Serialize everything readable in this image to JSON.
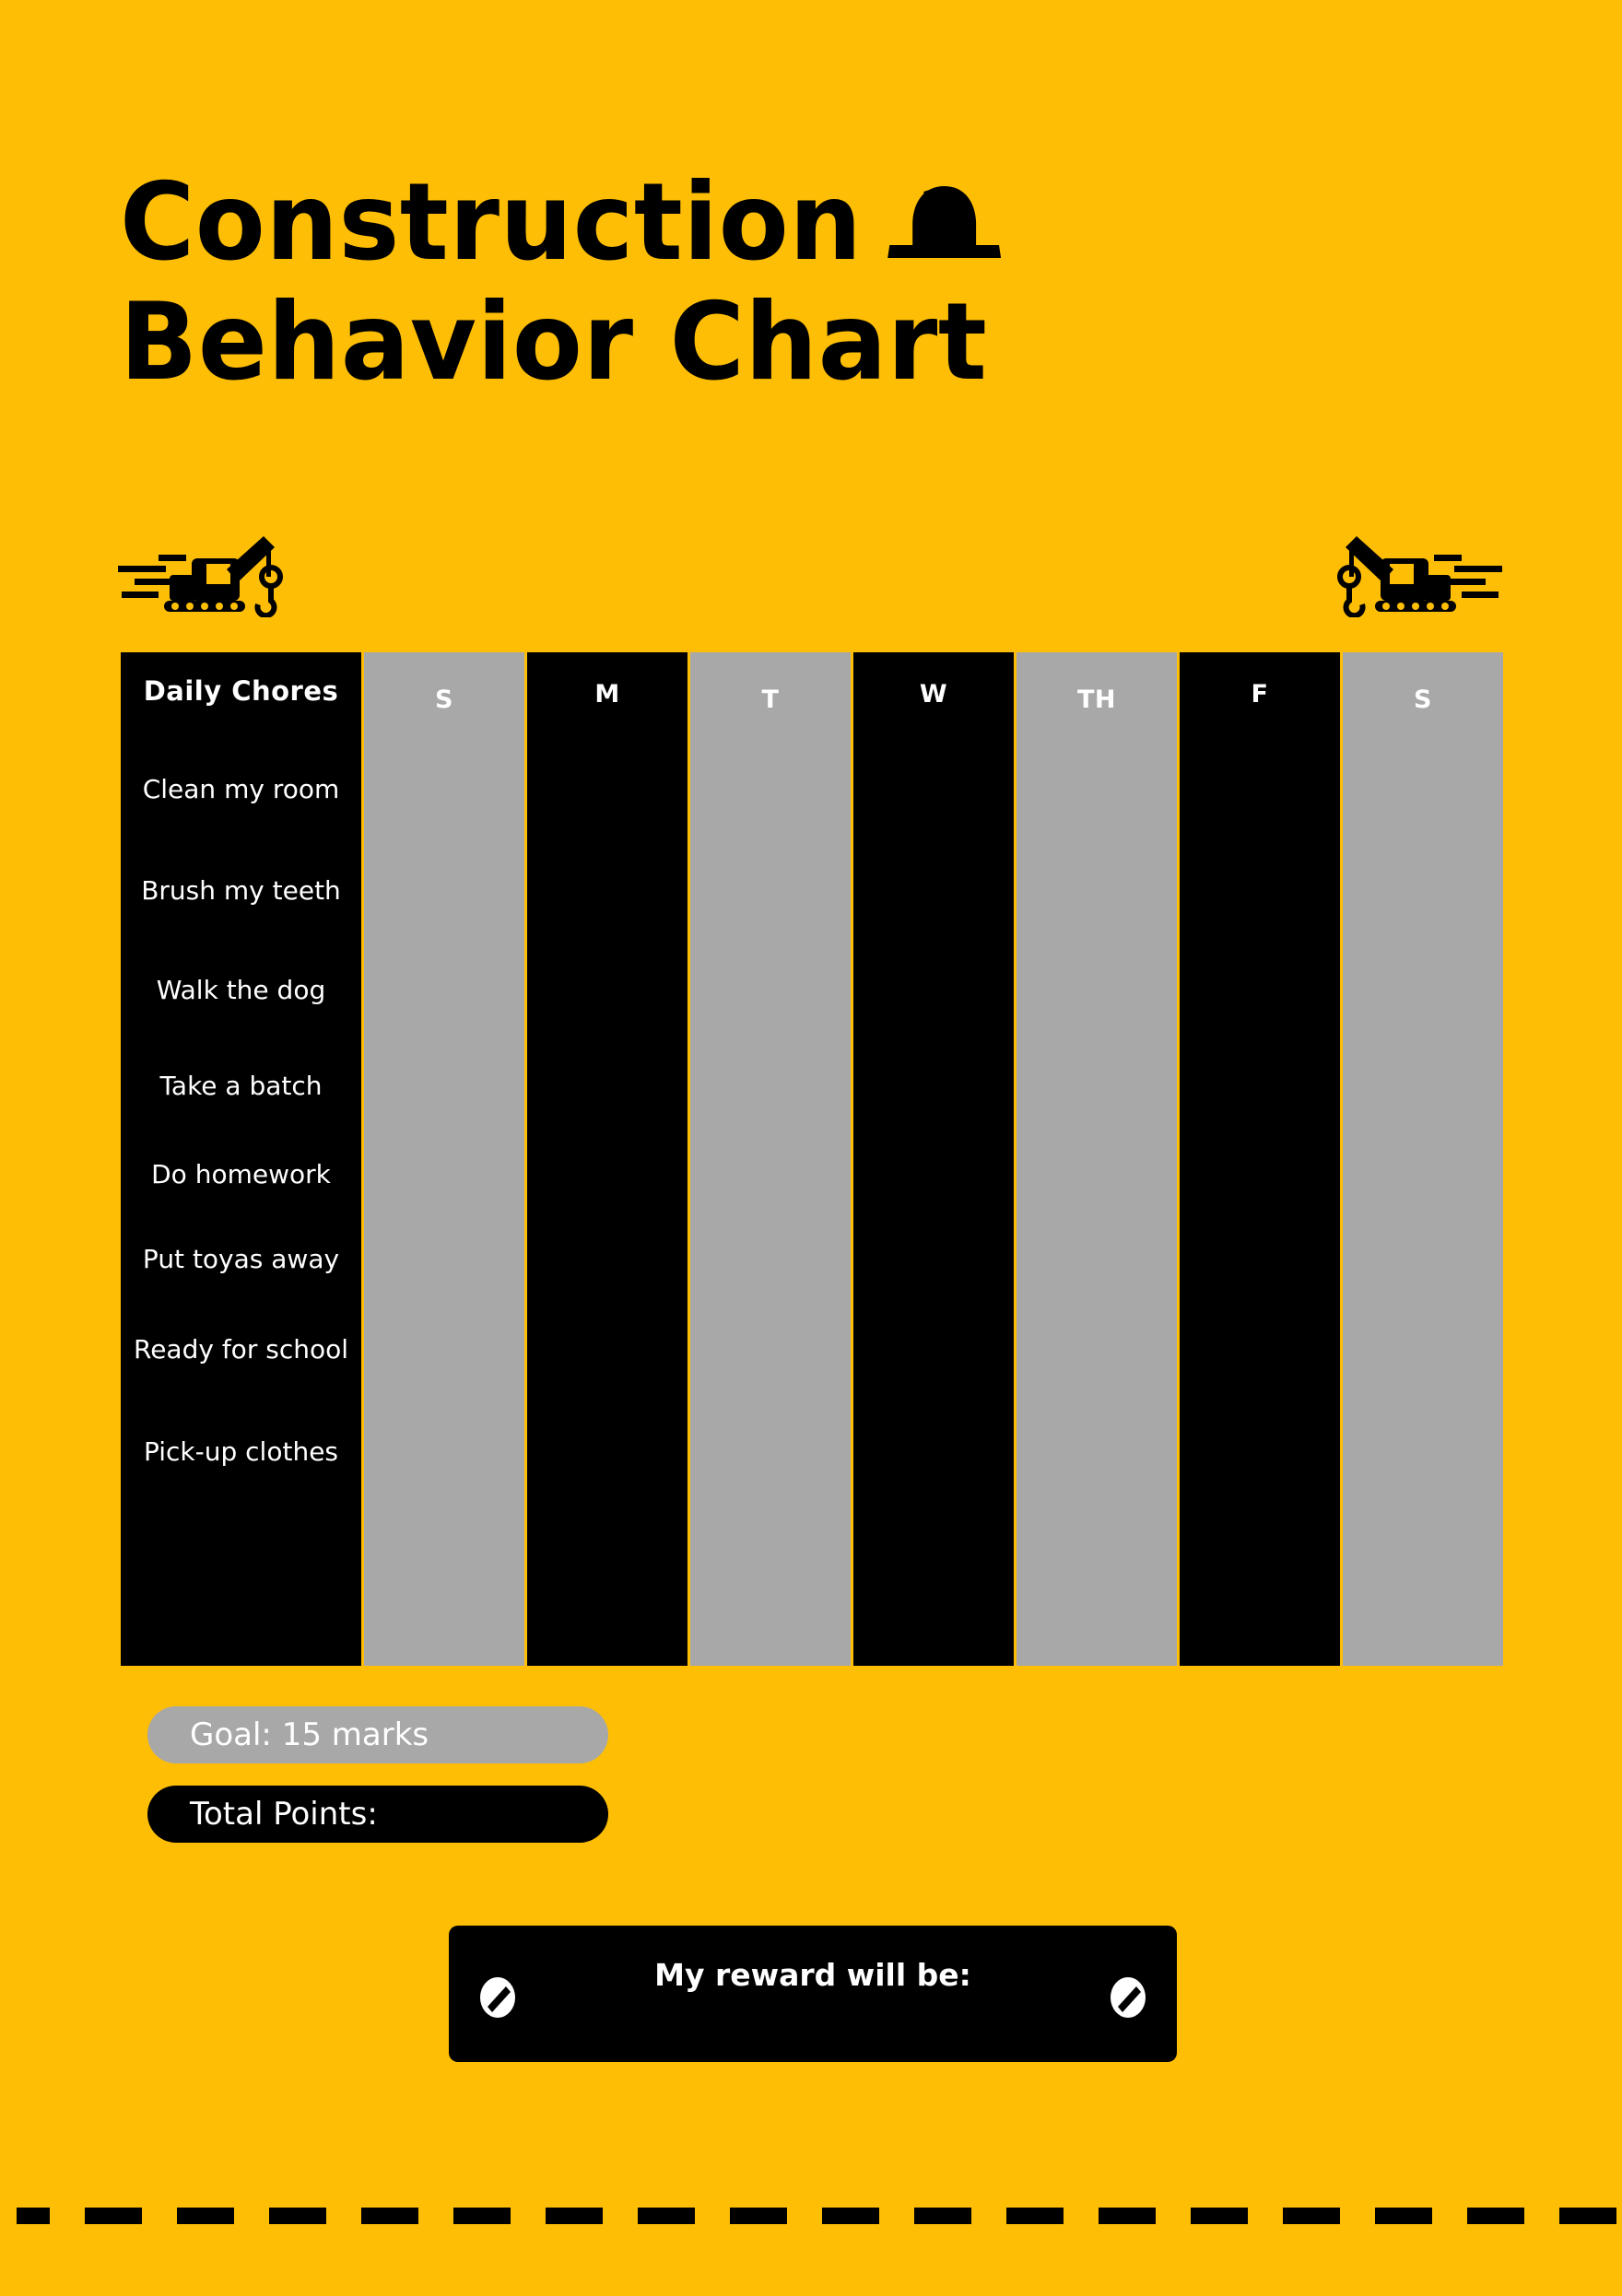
{
  "page": {
    "background_color": "#FEBE05",
    "accent_dark": "#000000",
    "accent_gray": "#A8A8A8",
    "text_light": "#FFFFFF"
  },
  "title": {
    "line1": "Construction",
    "line2": "Behavior Chart",
    "hardhat_icon": "hard-hat-icon"
  },
  "decor": {
    "crane_left_icon": "crane-icon",
    "crane_right_icon": "crane-icon",
    "road_dash_count": 22
  },
  "chart_data": {
    "type": "table",
    "title": "Construction Behavior Chart",
    "columns": [
      {
        "label": "Daily Chores",
        "kind": "label",
        "fill": "#000000"
      },
      {
        "label": "S",
        "kind": "day",
        "fill": "#A8A8A8"
      },
      {
        "label": "M",
        "kind": "day",
        "fill": "#000000"
      },
      {
        "label": "T",
        "kind": "day",
        "fill": "#A8A8A8"
      },
      {
        "label": "W",
        "kind": "day",
        "fill": "#000000"
      },
      {
        "label": "TH",
        "kind": "day",
        "fill": "#A8A8A8"
      },
      {
        "label": "F",
        "kind": "day",
        "fill": "#000000"
      },
      {
        "label": "S",
        "kind": "day",
        "fill": "#A8A8A8"
      }
    ],
    "rows": [
      {
        "chore": "Clean my room",
        "marks": [
          "",
          "",
          "",
          "",
          "",
          "",
          ""
        ]
      },
      {
        "chore": "Brush my teeth",
        "marks": [
          "",
          "",
          "",
          "",
          "",
          "",
          ""
        ]
      },
      {
        "chore": "Walk the dog",
        "marks": [
          "",
          "",
          "",
          "",
          "",
          "",
          ""
        ]
      },
      {
        "chore": "Take a batch",
        "marks": [
          "",
          "",
          "",
          "",
          "",
          "",
          ""
        ]
      },
      {
        "chore": "Do homework",
        "marks": [
          "",
          "",
          "",
          "",
          "",
          "",
          ""
        ]
      },
      {
        "chore": "Put toyas away",
        "marks": [
          "",
          "",
          "",
          "",
          "",
          "",
          ""
        ]
      },
      {
        "chore": "Ready for school",
        "marks": [
          "",
          "",
          "",
          "",
          "",
          "",
          ""
        ]
      },
      {
        "chore": "Pick-up clothes",
        "marks": [
          "",
          "",
          "",
          "",
          "",
          "",
          ""
        ]
      }
    ]
  },
  "summary": {
    "goal_label": "Goal: 15 marks",
    "goal_value": 15,
    "total_points_label": "Total Points:",
    "total_points_value": ""
  },
  "reward": {
    "label": "My reward will be:",
    "value": "",
    "screw_left_icon": "screw-slash-icon",
    "screw_right_icon": "screw-slash-icon"
  }
}
